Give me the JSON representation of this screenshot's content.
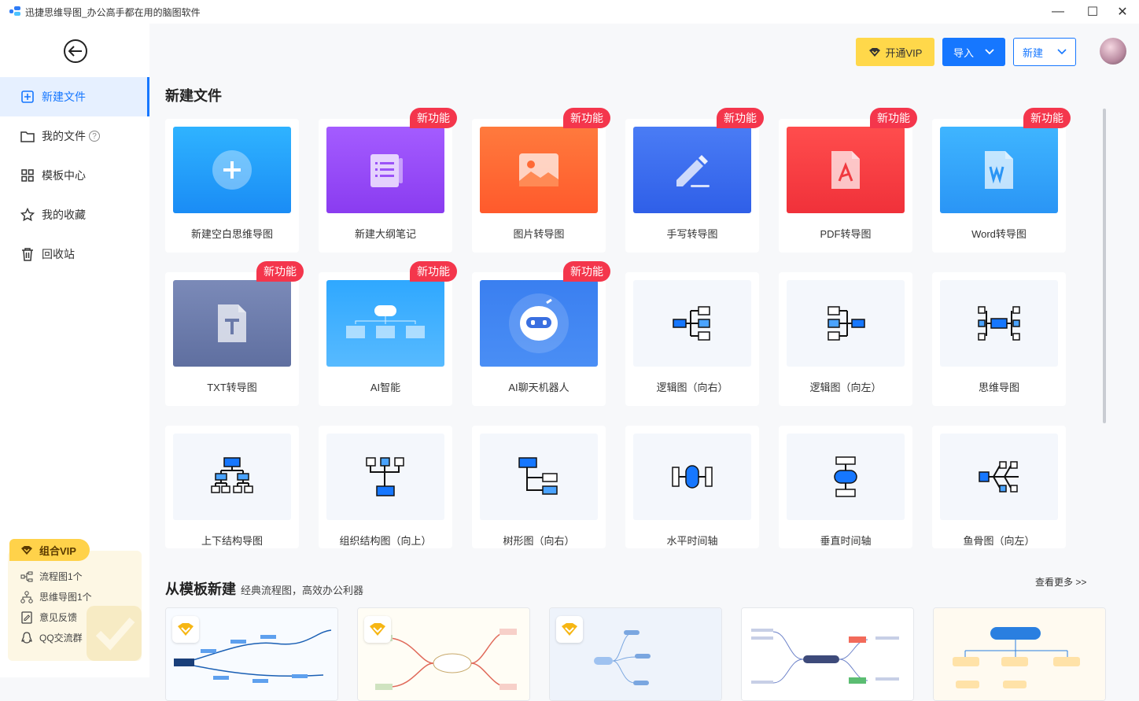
{
  "window": {
    "title": "迅捷思维导图_办公高手都在用的脑图软件",
    "minimize": "—",
    "maximize": "☐",
    "close": "✕"
  },
  "sidebar": {
    "items": [
      {
        "label": "新建文件"
      },
      {
        "label": "我的文件"
      },
      {
        "label": "模板中心"
      },
      {
        "label": "我的收藏"
      },
      {
        "label": "回收站"
      }
    ],
    "vip": {
      "title": "组合VIP",
      "rows": [
        {
          "label": "流程图1个"
        },
        {
          "label": "思维导图1个"
        },
        {
          "label": "意见反馈"
        },
        {
          "label": "QQ交流群"
        }
      ]
    }
  },
  "header": {
    "vip_label": "开通VIP",
    "import_label": "导入",
    "new_label": "新建"
  },
  "new_file": {
    "title": "新建文件",
    "badge": "新功能",
    "cards": [
      {
        "label": "新建空白思维导图"
      },
      {
        "label": "新建大纲笔记"
      },
      {
        "label": "图片转导图"
      },
      {
        "label": "手写转导图"
      },
      {
        "label": "PDF转导图"
      },
      {
        "label": "Word转导图"
      },
      {
        "label": "TXT转导图"
      },
      {
        "label": "AI智能"
      },
      {
        "label": "AI聊天机器人"
      },
      {
        "label": "逻辑图（向右）"
      },
      {
        "label": "逻辑图（向左）"
      },
      {
        "label": "思维导图"
      },
      {
        "label": "上下结构导图"
      },
      {
        "label": "组织结构图（向上）"
      },
      {
        "label": "树形图（向右）"
      },
      {
        "label": "水平时间轴"
      },
      {
        "label": "垂直时间轴"
      },
      {
        "label": "鱼骨图（向左）"
      }
    ]
  },
  "template": {
    "title": "从模板新建",
    "subtitle": "经典流程图，高效办公利器",
    "more": "查看更多 >>"
  },
  "colors": {
    "accent": "#1677ff",
    "badge": "#f4364c",
    "vip": "#ffd84a"
  }
}
